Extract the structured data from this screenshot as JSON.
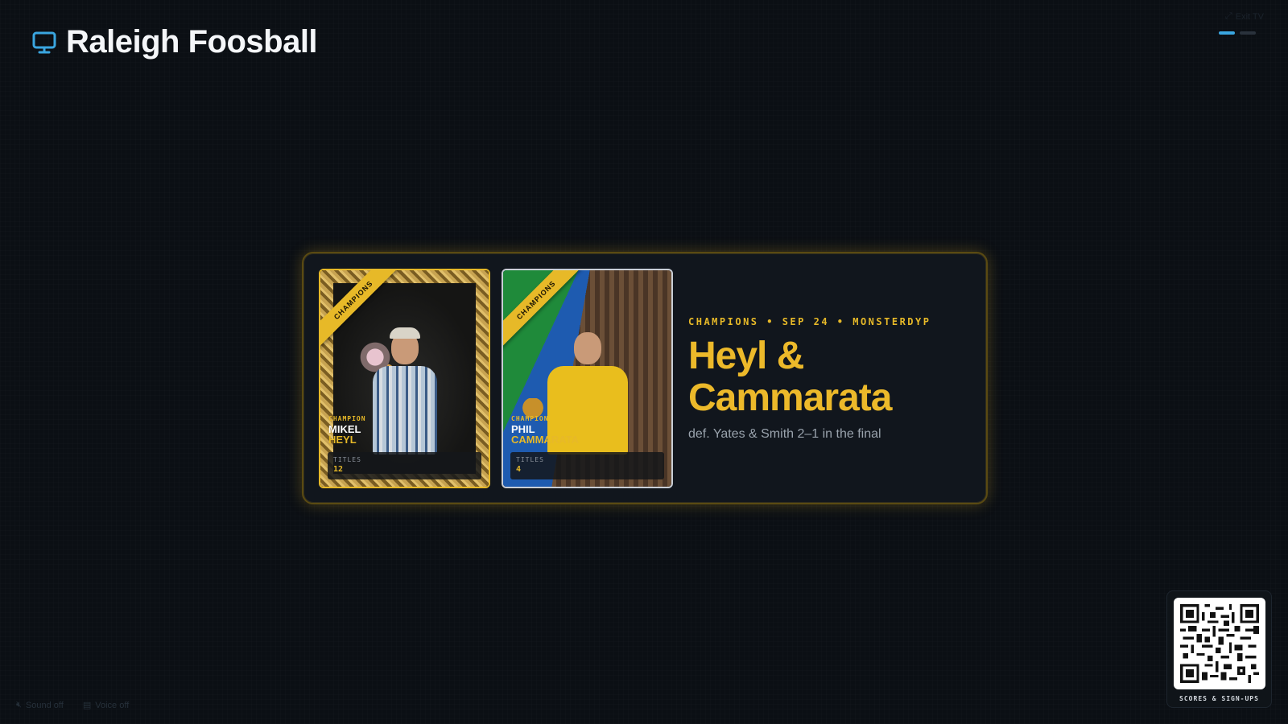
{
  "header": {
    "title": "Raleigh Foosball",
    "icon": "monitor-icon"
  },
  "top_right": {
    "exit_label": "Exit TV",
    "pager": {
      "total": 2,
      "active": 1
    }
  },
  "feature": {
    "eyebrow": "CHAMPIONS • SEP 24 • MONSTERDYP",
    "title_line1": "Heyl &",
    "title_line2": "Cammarata",
    "subtitle": "def. Yates & Smith 2–1 in the final",
    "players": [
      {
        "ribbon": "CHAMPIONS",
        "role": "CHAMPION",
        "first_name": "MIKEL",
        "last_name": "HEYL",
        "stat_label": "TITLES",
        "stat_value": "12"
      },
      {
        "ribbon": "CHAMPIONS",
        "role": "CHAMPION",
        "first_name": "PHIL",
        "last_name": "CAMMARATA",
        "stat_label": "TITLES",
        "stat_value": "4"
      }
    ]
  },
  "qr": {
    "label": "SCORES & SIGN-UPS"
  },
  "footer": {
    "sound_label": "Sound off",
    "voice_label": "Voice off"
  },
  "colors": {
    "accent_gold": "#e7b928",
    "accent_blue": "#3aa6e0",
    "background": "#0b0f14"
  }
}
